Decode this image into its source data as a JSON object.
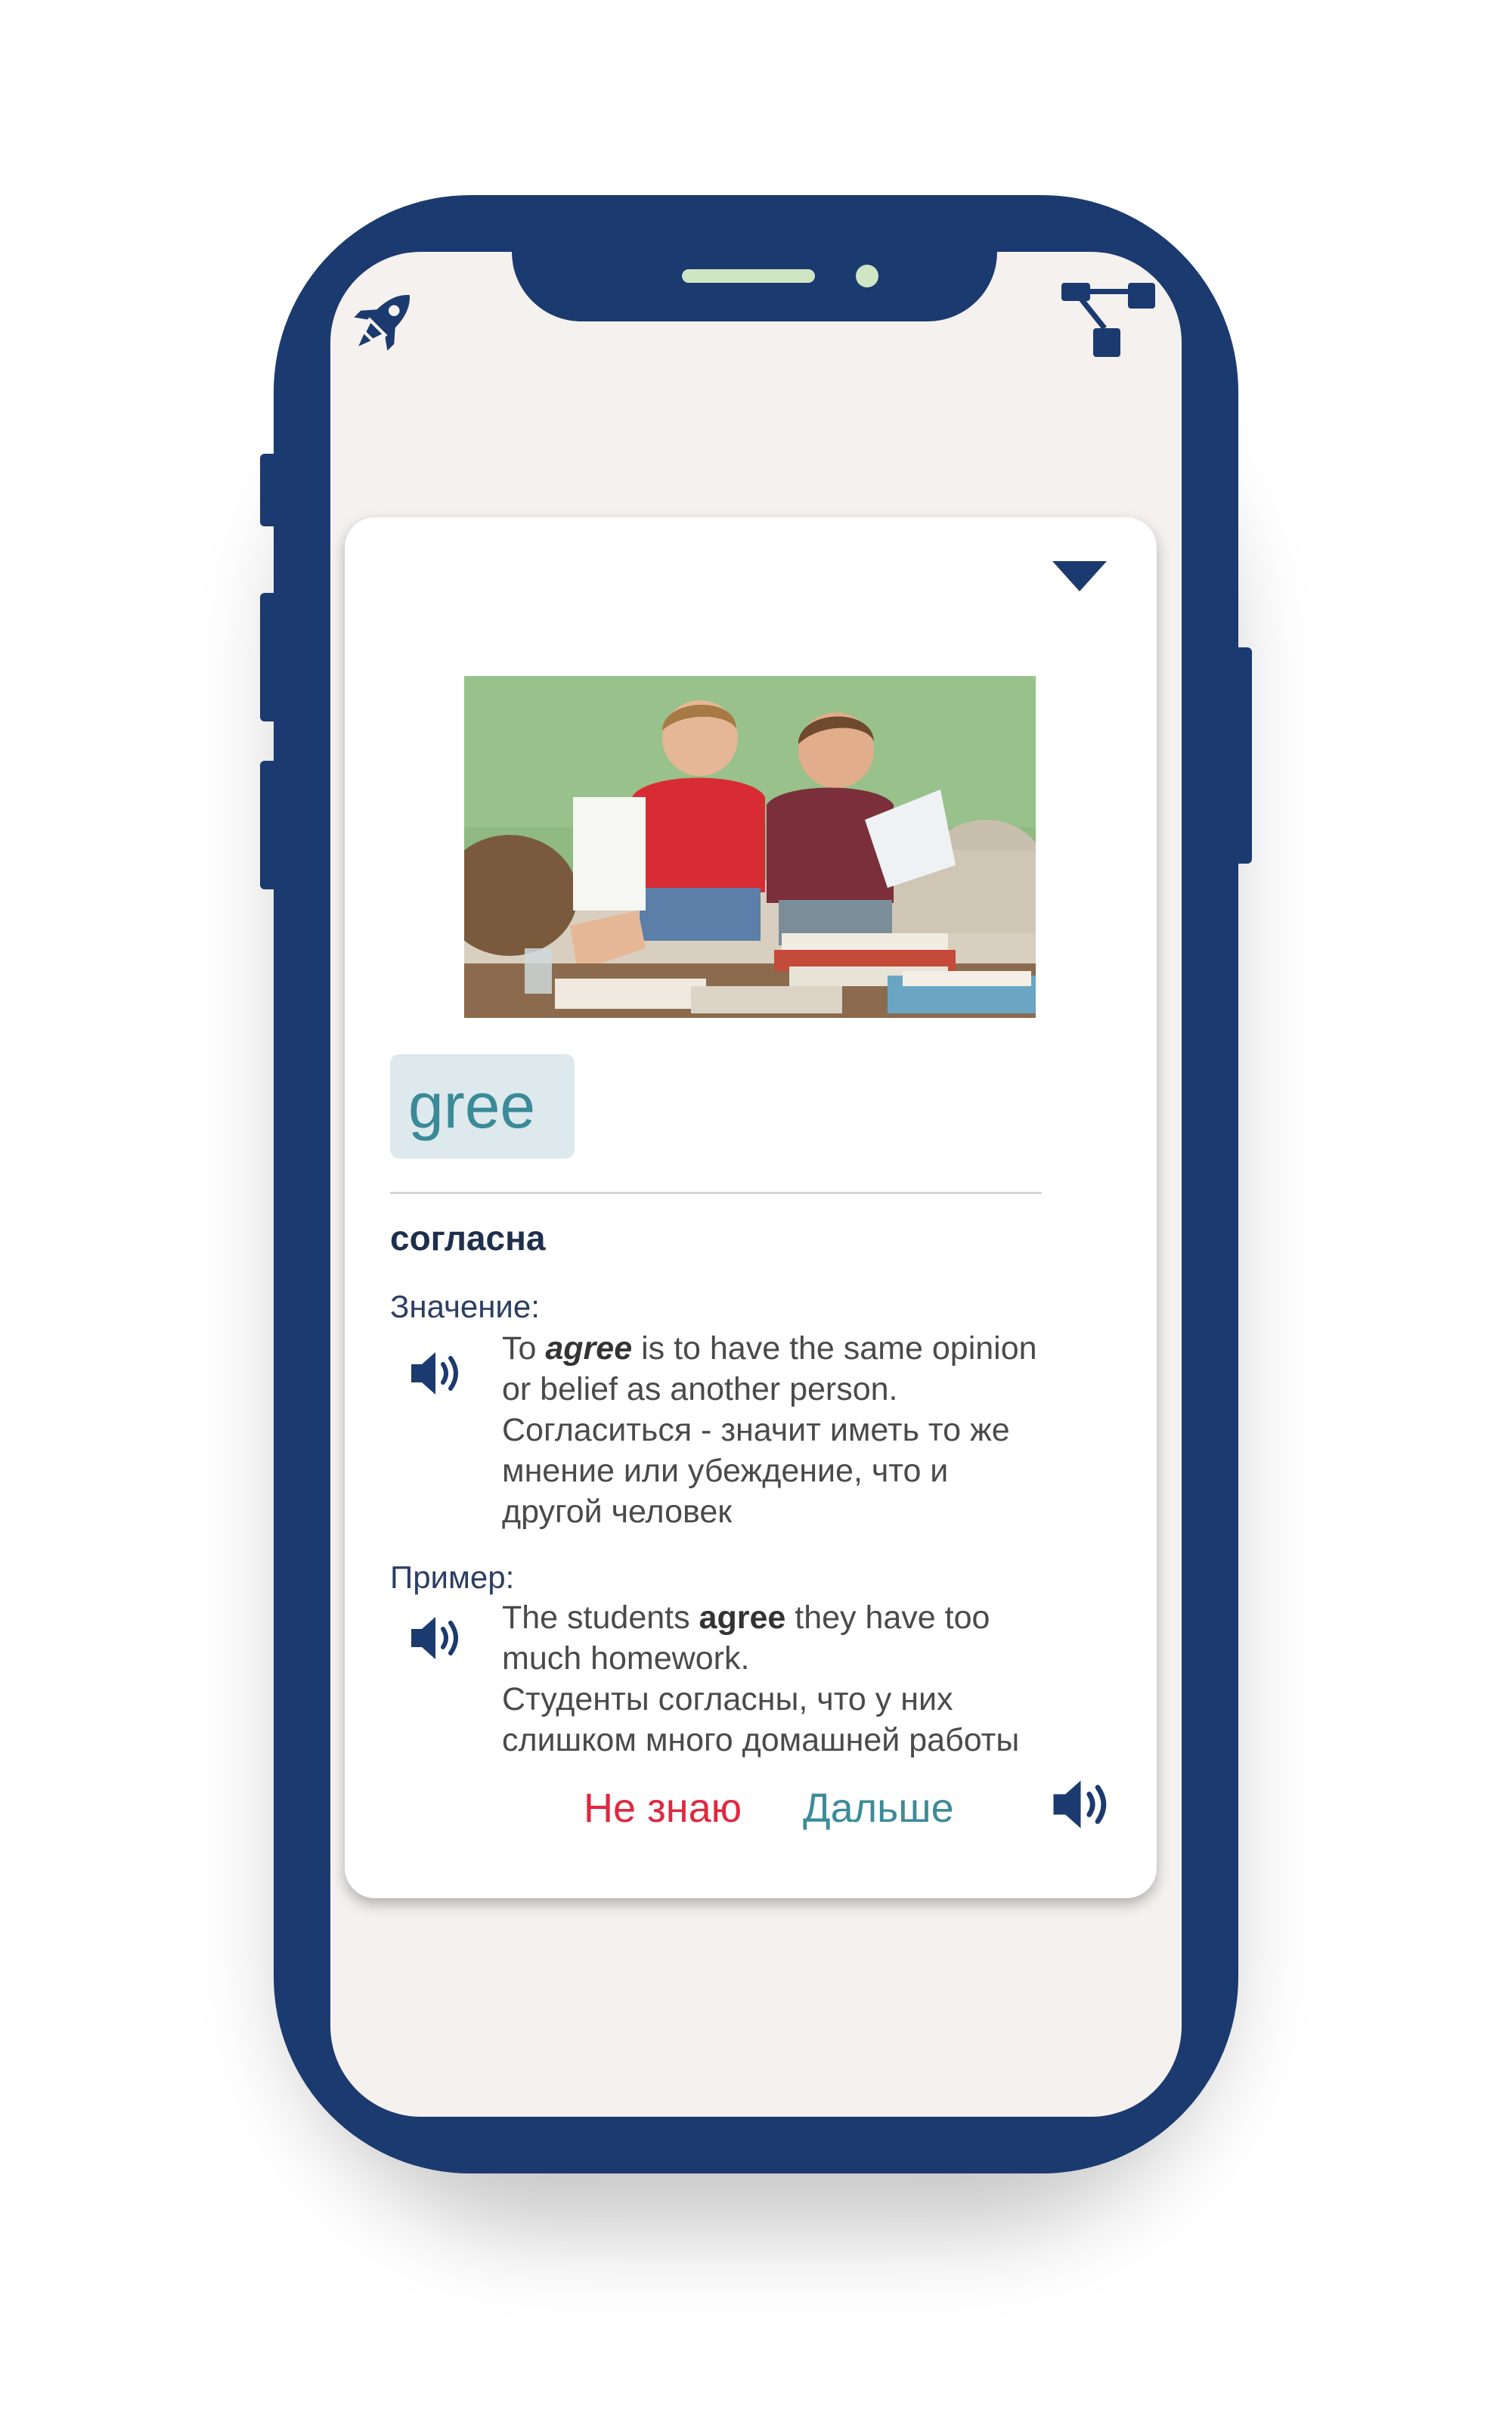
{
  "app": {
    "top_left_icon": "rocket-icon",
    "top_right_icon": "sitemap-icon",
    "colors": {
      "phone_frame": "#1b3a6f",
      "screen_bg": "#f5f1ee",
      "word_accent": "#3a8a97",
      "dont_know": "#e0283e",
      "next": "#3d8b99"
    }
  },
  "card": {
    "collapse_icon": "chevron-down-icon",
    "word": "gree",
    "translation": "согласна",
    "meaning": {
      "label": "Значение:",
      "line1_pre": "To ",
      "line1_em": "agree",
      "line1_post": " is to have the same opinion",
      "line2": "or belief as another person.",
      "line3": "Согласиться - значит иметь то же",
      "line4": "мнение или убеждение, что и",
      "line5": "другой человек"
    },
    "example": {
      "label": "Пример:",
      "line1_pre": "The students ",
      "line1_strong": "agree",
      "line1_post": " they have too",
      "line2": "much homework.",
      "line3": "Студенты согласны, что у них",
      "line4": "слишком много домашней работы"
    },
    "buttons": {
      "dont_know": "Не знаю",
      "next": "Дальше"
    }
  }
}
